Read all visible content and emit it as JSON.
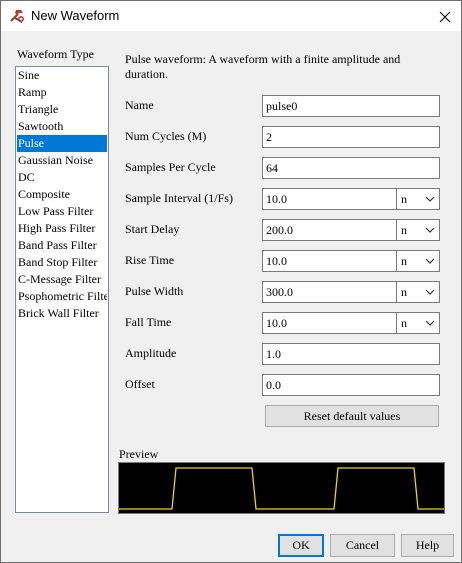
{
  "window": {
    "title": "New Waveform",
    "icon": "tools-icon",
    "close_icon": "close-icon"
  },
  "waveform_type": {
    "label": "Waveform Type",
    "selected": "Pulse",
    "items": [
      "Sine",
      "Ramp",
      "Triangle",
      "Sawtooth",
      "Pulse",
      "Gaussian Noise",
      "DC",
      "Composite",
      "Low Pass Filter",
      "High Pass Filter",
      "Band Pass Filter",
      "Band Stop Filter",
      "C-Message Filter",
      "Psophometric Filter",
      "Brick Wall Filter"
    ]
  },
  "description": "Pulse waveform:  A waveform with a finite amplitude and duration.",
  "fields": {
    "name": {
      "label": "Name",
      "value": "pulse0"
    },
    "num_cycles": {
      "label": "Num Cycles (M)",
      "value": "2"
    },
    "samples_per_cycle": {
      "label": "Samples Per Cycle",
      "value": "64"
    },
    "sample_interval": {
      "label": "Sample Interval (1/Fs)",
      "value": "10.0",
      "unit": "n"
    },
    "start_delay": {
      "label": "Start Delay",
      "value": "200.0",
      "unit": "n"
    },
    "rise_time": {
      "label": "Rise Time",
      "value": "10.0",
      "unit": "n"
    },
    "pulse_width": {
      "label": "Pulse Width",
      "value": "300.0",
      "unit": "n"
    },
    "fall_time": {
      "label": "Fall Time",
      "value": "10.0",
      "unit": "n"
    },
    "amplitude": {
      "label": "Amplitude",
      "value": "1.0"
    },
    "offset": {
      "label": "Offset",
      "value": "0.0"
    }
  },
  "reset_button": "Reset default values",
  "preview": {
    "label": "Preview",
    "trace_color": "#e8d800",
    "background": "#000000"
  },
  "buttons": {
    "ok": "OK",
    "cancel": "Cancel",
    "help": "Help"
  },
  "colors": {
    "selection": "#0078d7",
    "dialog_bg": "#f0f0f0"
  }
}
